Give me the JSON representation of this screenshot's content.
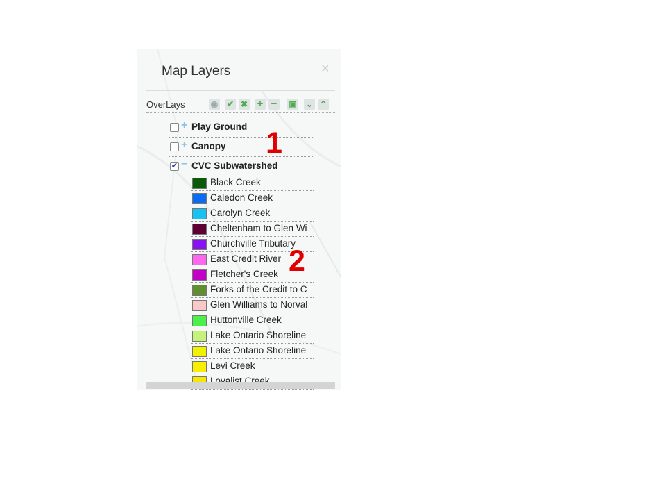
{
  "panel": {
    "title": "Map Layers",
    "close_icon": "close-icon",
    "overlays_label": "OverLays",
    "toolbar_icons": [
      "globe-icon",
      "check-icon",
      "x-icon",
      "plus-icon",
      "minus-icon",
      "save-icon",
      "chevron-down-icon",
      "chevron-up-icon"
    ],
    "toolbar_glyphs": [
      "◉",
      "✔",
      "✖",
      "+",
      "−",
      "▣",
      "⌄",
      "⌃"
    ]
  },
  "tree": [
    {
      "label": "Play Ground",
      "checked": false,
      "expanded": false
    },
    {
      "label": "Canopy",
      "checked": false,
      "expanded": false
    },
    {
      "label": "CVC Subwatershed",
      "checked": true,
      "expanded": true
    }
  ],
  "legend": [
    {
      "label": "Black Creek",
      "color": "#0b5a0b"
    },
    {
      "label": "Caledon Creek",
      "color": "#0a6cf2"
    },
    {
      "label": "Carolyn Creek",
      "color": "#16c2f2"
    },
    {
      "label": "Cheltenham to Glen Wi",
      "color": "#5e0033"
    },
    {
      "label": "Churchville Tributary",
      "color": "#8a12f2"
    },
    {
      "label": "East Credit River",
      "color": "#ff66f0"
    },
    {
      "label": "Fletcher's Creek",
      "color": "#c200c8"
    },
    {
      "label": "Forks of the Credit to C",
      "color": "#5e8f2e"
    },
    {
      "label": "Glen Williams to Norval",
      "color": "#fbc8c8"
    },
    {
      "label": "Huttonville Creek",
      "color": "#4cf04c"
    },
    {
      "label": "Lake Ontario Shoreline",
      "color": "#c4f27a"
    },
    {
      "label": "Lake Ontario Shoreline",
      "color": "#f2f200"
    },
    {
      "label": "Levi Creek",
      "color": "#f8f000"
    },
    {
      "label": "Loyalist Creek",
      "color": "#f6e800"
    }
  ],
  "annotations": {
    "one": "1",
    "two": "2"
  },
  "colors": {
    "annotation": "#e00000",
    "toolbar_accent": "#4cae4c",
    "expander": "#86c5e6"
  }
}
